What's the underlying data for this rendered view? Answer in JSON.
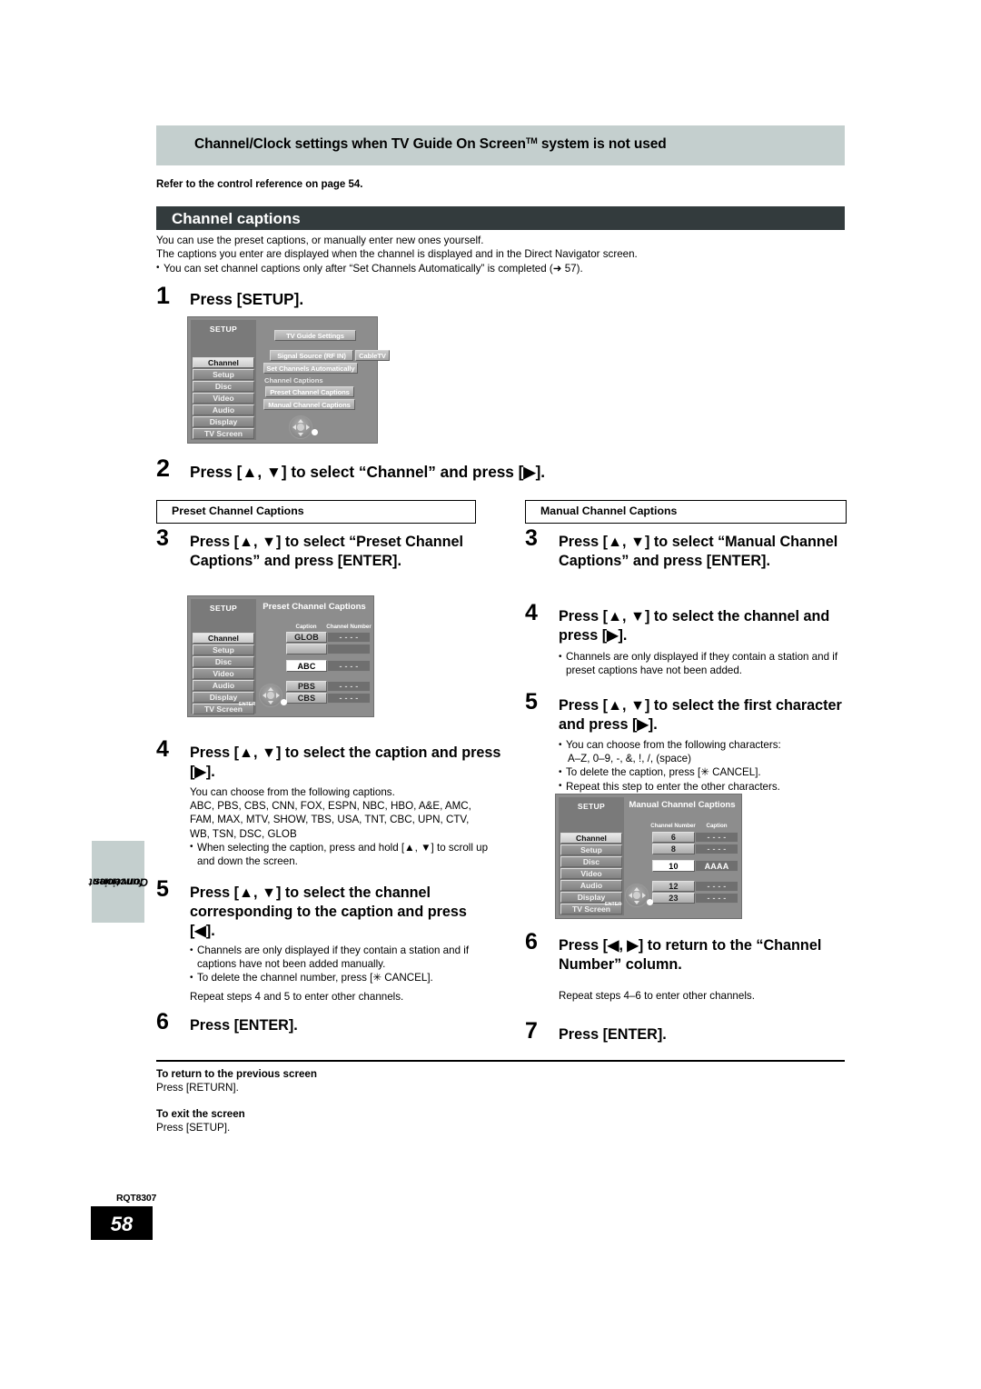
{
  "banner": {
    "title_before": "Channel/Clock settings when TV Guide On Screen",
    "title_tm": "TM",
    "title_after": " system is not used"
  },
  "reference_line": "Refer to the control reference on page 54.",
  "section": {
    "title": "Channel captions",
    "intro_line1": "You can use the preset captions, or manually enter new ones yourself.",
    "intro_line2": "The captions you enter are displayed when the channel is displayed and in the Direct Navigator screen.",
    "intro_bullet": "You can set channel captions only after “Set Channels Automatically” is completed (➜ 57)."
  },
  "steps": {
    "step1": "Press [SETUP].",
    "step2": "Press [▲, ▼] to select “Channel” and press [▶].",
    "left": {
      "header": "Preset Channel Captions",
      "step3": "Press [▲, ▼] to select “Preset Channel Captions” and press [ENTER].",
      "step4": "Press [▲, ▼] to select the caption and press [▶].",
      "step4_note_line1": "You can choose from the following captions.",
      "step4_note_line2": "ABC, PBS, CBS, CNN, FOX, ESPN, NBC, HBO, A&E, AMC,",
      "step4_note_line3": "FAM, MAX, MTV, SHOW, TBS, USA, TNT, CBC, UPN, CTV,",
      "step4_note_line4": "WB, TSN, DSC, GLOB",
      "step4_bullet": "When selecting the caption, press and hold [▲, ▼] to scroll up and down the screen.",
      "step5": "Press [▲, ▼] to select the channel corresponding to the caption and press [◀].",
      "step5_bullet1": "Channels are only displayed if they contain a station and if captions have not been added manually.",
      "step5_bullet2": "To delete the channel number, press [✳ CANCEL].",
      "step5_repeat": "Repeat steps 4 and 5 to enter other channels.",
      "step6": "Press [ENTER]."
    },
    "right": {
      "header": "Manual Channel Captions",
      "step3": "Press [▲, ▼] to select “Manual Channel Captions” and press [ENTER].",
      "step4": "Press [▲, ▼] to select the channel and press [▶].",
      "step4_bullet": "Channels are only displayed if they contain a station and if preset captions have not been added.",
      "step5": "Press [▲, ▼] to select the first character and press [▶].",
      "step5_bullet1_a": "You can choose from the following characters:",
      "step5_bullet1_b": "A–Z, 0–9, -, &, !, /, (space)",
      "step5_bullet2": "To delete the caption, press [✳ CANCEL].",
      "step5_bullet3": "Repeat this step to enter the other characters.",
      "step6": "Press [◀, ▶] to return to the “Channel Number” column.",
      "step6_repeat": "Repeat steps 4–6 to enter other channels.",
      "step7": "Press [ENTER]."
    }
  },
  "osd_menu1": {
    "setup_label": "SETUP",
    "sidebar": [
      "Channel",
      "Setup",
      "Disc",
      "Video",
      "Audio",
      "Display",
      "TV Screen"
    ],
    "active_index": 0,
    "items": {
      "tv_guide_settings": "TV Guide Settings",
      "signal_source": "Signal Source (RF IN)",
      "signal_source_value": "CableTV",
      "set_channels_auto": "Set Channels Automatically",
      "channel_captions": "Channel Captions",
      "preset_channel_captions": "Preset Channel Captions",
      "manual_channel_captions": "Manual Channel Captions"
    }
  },
  "osd_menu2": {
    "setup_label": "SETUP",
    "title": "Preset Channel Captions",
    "sidebar": [
      "Channel",
      "Setup",
      "Disc",
      "Video",
      "Audio",
      "Display",
      "TV Screen"
    ],
    "active_index": 0,
    "col_caption": "Caption",
    "col_channel_number": "Channel Number",
    "enter_label": "ENTER",
    "rows": [
      {
        "caption": "GLOB",
        "number": "- - - -",
        "highlight": false
      },
      {
        "caption": "",
        "number": "",
        "highlight": false
      },
      {
        "caption": "ABC",
        "number": "- - - -",
        "highlight": true
      },
      {
        "caption": "PBS",
        "number": "- - - -",
        "highlight": false
      },
      {
        "caption": "CBS",
        "number": "- - - -",
        "highlight": false
      }
    ]
  },
  "osd_menu3": {
    "setup_label": "SETUP",
    "title": "Manual Channel Captions",
    "sidebar": [
      "Channel",
      "Setup",
      "Disc",
      "Video",
      "Audio",
      "Display",
      "TV Screen"
    ],
    "active_index": 0,
    "col_channel_number": "Channel Number",
    "col_caption": "Caption",
    "enter_label": "ENTER",
    "rows": [
      {
        "number": "6",
        "caption": "- - - -",
        "highlight": false
      },
      {
        "number": "8",
        "caption": "- - - -",
        "highlight": false
      },
      {
        "number": "10",
        "caption": "AAAA",
        "highlight": true
      },
      {
        "number": "12",
        "caption": "- - - -",
        "highlight": false
      },
      {
        "number": "23",
        "caption": "- - - -",
        "highlight": false
      }
    ]
  },
  "endnotes": {
    "return_title": "To return to the previous screen",
    "return_body": "Press [RETURN].",
    "exit_title": "To exit the screen",
    "exit_body": "Press [SETUP]."
  },
  "side_tab": {
    "line1": "Convenient",
    "line2": "functions"
  },
  "footer": {
    "rqt": "RQT8307",
    "page": "58"
  },
  "colors": {
    "banner_bg": "#c4cfce",
    "section_bg": "#333b3d",
    "page_box": "#000000"
  }
}
